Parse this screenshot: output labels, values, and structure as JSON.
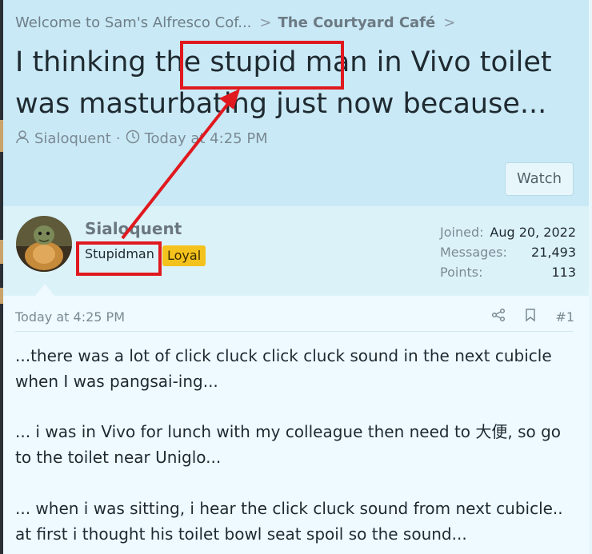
{
  "breadcrumb": {
    "items": [
      {
        "label": "Welcome to Sam's Alfresco Cof..."
      },
      {
        "label": "The Courtyard Café"
      }
    ],
    "separator": ">"
  },
  "thread": {
    "title": "I thinking the stupid man in Vivo toilet was masturbating just now because...",
    "author": "Sialoquent",
    "separator": "·",
    "time": "Today at 4:25 PM",
    "watch_label": "Watch"
  },
  "post": {
    "username": "Sialoquent",
    "user_title": "Stupidman",
    "badge": "Loyal",
    "stats": [
      {
        "key": "Joined:",
        "value": "Aug 20, 2022"
      },
      {
        "key": "Messages:",
        "value": "21,493"
      },
      {
        "key": "Points:",
        "value": "113"
      }
    ],
    "time": "Today at 4:25 PM",
    "number": "#1",
    "paragraphs": [
      "...there was a lot of click cluck click cluck sound in the next cubicle when I was pangsai-ing...",
      "... i was in Vivo for lunch with my colleague then need to 大便, so go to the toilet near Uniglo...",
      "... when i was sitting, i hear the click cluck sound from next cubicle.. at first i thought his toilet bowl seat spoil so the sound..."
    ]
  },
  "colors": {
    "annotation": "#e0191f",
    "badge": "#f4c21c",
    "header_bg": "#c9e9f6"
  },
  "icons": [
    "user-icon",
    "clock-icon",
    "share-icon",
    "bookmark-icon",
    "avatar-turtle"
  ]
}
